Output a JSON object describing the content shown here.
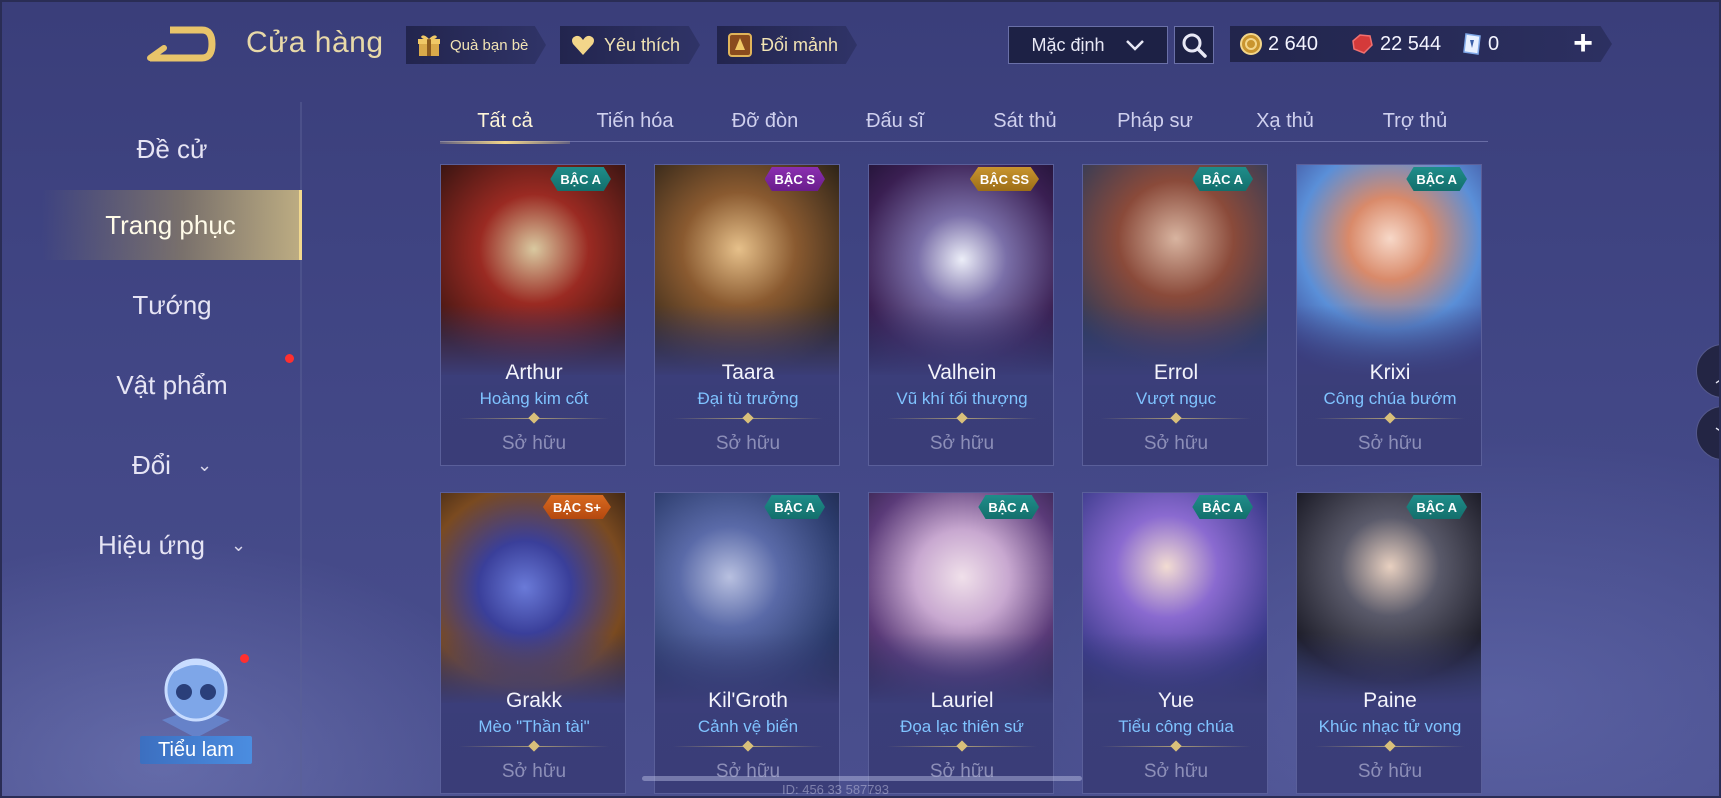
{
  "header": {
    "title": "Cửa hàng",
    "gift_label": "Quà bạn bè",
    "favorite_label": "Yêu thích",
    "exchange_label": "Đổi mảnh",
    "sort_value": "Mặc định"
  },
  "currency": {
    "gold": "2 640",
    "gems": "22 544",
    "tickets": "0",
    "plus": "+"
  },
  "sidebar": {
    "items": [
      {
        "label": "Đề cử"
      },
      {
        "label": "Trang phục"
      },
      {
        "label": "Tướng"
      },
      {
        "label": "Vật phẩm"
      },
      {
        "label": "Đổi"
      },
      {
        "label": "Hiệu ứng"
      }
    ],
    "mascot_label": "Tiểu lam"
  },
  "tabs": [
    {
      "label": "Tất cả"
    },
    {
      "label": "Tiến hóa"
    },
    {
      "label": "Đỡ đòn"
    },
    {
      "label": "Đấu sĩ"
    },
    {
      "label": "Sát thủ"
    },
    {
      "label": "Pháp sư"
    },
    {
      "label": "Xạ thủ"
    },
    {
      "label": "Trợ thủ"
    }
  ],
  "cards": [
    {
      "hero": "Arthur",
      "skin": "Hoàng kim cốt",
      "tier": "BẬC A",
      "status": "Sở hữu"
    },
    {
      "hero": "Taara",
      "skin": "Đại tù trưởng",
      "tier": "BẬC S",
      "status": "Sở hữu"
    },
    {
      "hero": "Valhein",
      "skin": "Vũ khí tối thượng",
      "tier": "BẬC SS",
      "status": "Sở hữu"
    },
    {
      "hero": "Errol",
      "skin": "Vượt ngục",
      "tier": "BẬC A",
      "status": "Sở hữu"
    },
    {
      "hero": "Krixi",
      "skin": "Công chúa bướm",
      "tier": "BẬC A",
      "status": "Sở hữu"
    },
    {
      "hero": "Grakk",
      "skin": "Mèo \"Thần tài\"",
      "tier": "BẬC S+",
      "status": "Sở hữu"
    },
    {
      "hero": "Kil'Groth",
      "skin": "Cảnh vệ biển",
      "tier": "BẬC A",
      "status": "Sở hữu"
    },
    {
      "hero": "Lauriel",
      "skin": "Đọa lạc thiên sứ",
      "tier": "BẬC A",
      "status": "Sở hữu"
    },
    {
      "hero": "Yue",
      "skin": "Tiểu công chúa",
      "tier": "BẬC A",
      "status": "Sở hữu"
    },
    {
      "hero": "Paine",
      "skin": "Khúc nhạc tử vong",
      "tier": "BẬC A",
      "status": "Sở hữu"
    }
  ],
  "uid_text": "ID: 456 33 587793",
  "colors": {
    "accent_gold": "#f3d68a",
    "skin_name_blue": "#7fc3ff",
    "notification_red": "#ff2f2f"
  },
  "icons": [
    "back-arrow-icon",
    "gift-icon",
    "heart-icon",
    "shard-icon",
    "chevron-down-icon",
    "search-icon",
    "gold-coin-icon",
    "ruby-icon",
    "ticket-icon",
    "plus-icon",
    "chevron-up-icon"
  ]
}
